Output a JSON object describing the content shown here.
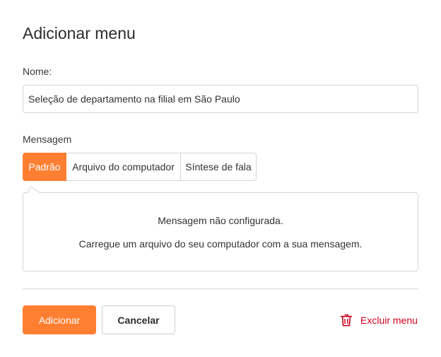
{
  "dialog": {
    "title": "Adicionar menu"
  },
  "name_field": {
    "label": "Nome:",
    "value": "Seleção de departamento na filial em São Paulo"
  },
  "message": {
    "label": "Mensagem",
    "tabs": [
      {
        "label": "Padrão",
        "active": true
      },
      {
        "label": "Arquivo do computador",
        "active": false
      },
      {
        "label": "Síntese de fala",
        "active": false
      }
    ],
    "panel_line1": "Mensagem não configurada.",
    "panel_line2": "Carregue um arquivo do seu computador com a sua mensagem."
  },
  "actions": {
    "add_label": "Adicionar",
    "cancel_label": "Cancelar",
    "delete_label": "Excluir menu",
    "delete_icon": "trash-icon"
  },
  "colors": {
    "accent": "#ff7f32",
    "danger": "#d0021b",
    "border": "#d6d6d6"
  }
}
